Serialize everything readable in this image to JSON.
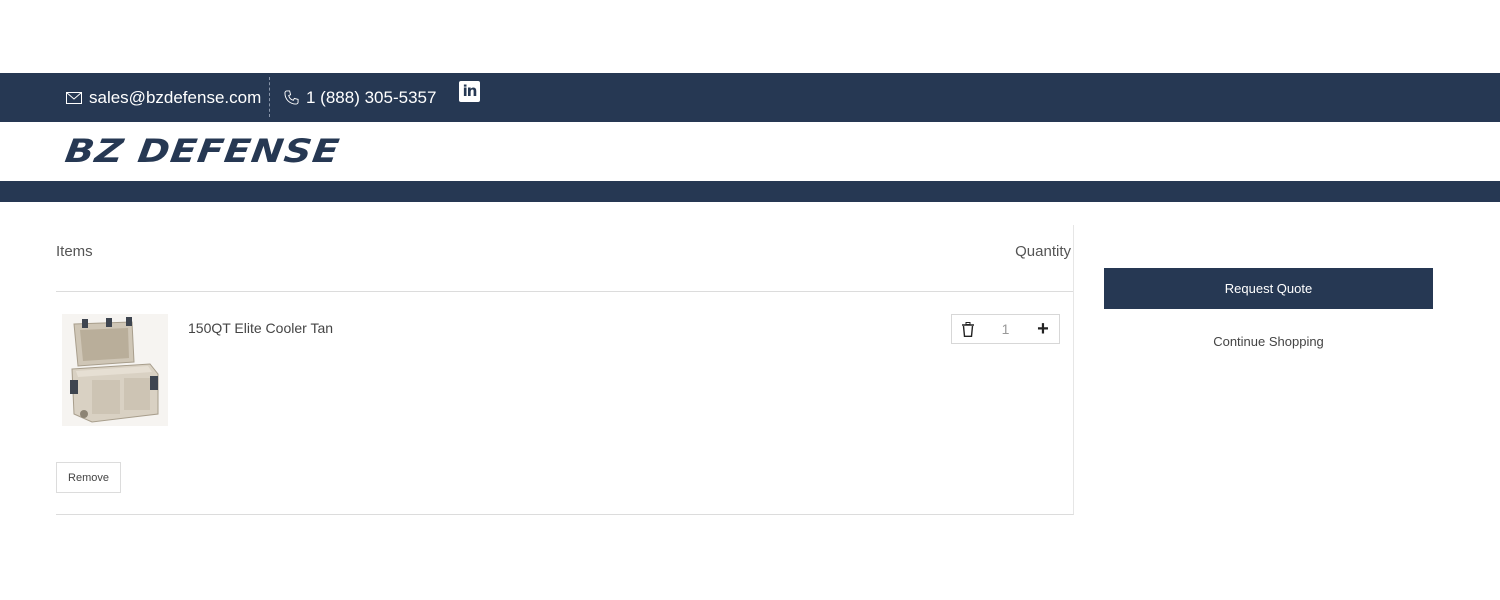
{
  "header": {
    "email": "sales@bzdefense.com",
    "phone": "1 (888) 305-5357",
    "social_icon": "linkedin-icon",
    "social_label": "in",
    "logo_text": "BZ DEFENSE",
    "brand_color": "#263853"
  },
  "cart": {
    "col_items": "Items",
    "col_quantity": "Quantity",
    "items": [
      {
        "name": "150QT Elite Cooler Tan",
        "image_icon": "cooler-product-image",
        "quantity": "1",
        "delete_icon": "trash-icon",
        "increment_icon": "plus-icon",
        "increment_label": "+"
      }
    ],
    "remove_label": "Remove"
  },
  "sidebar": {
    "request_quote_label": "Request Quote",
    "continue_label": "Continue Shopping"
  }
}
